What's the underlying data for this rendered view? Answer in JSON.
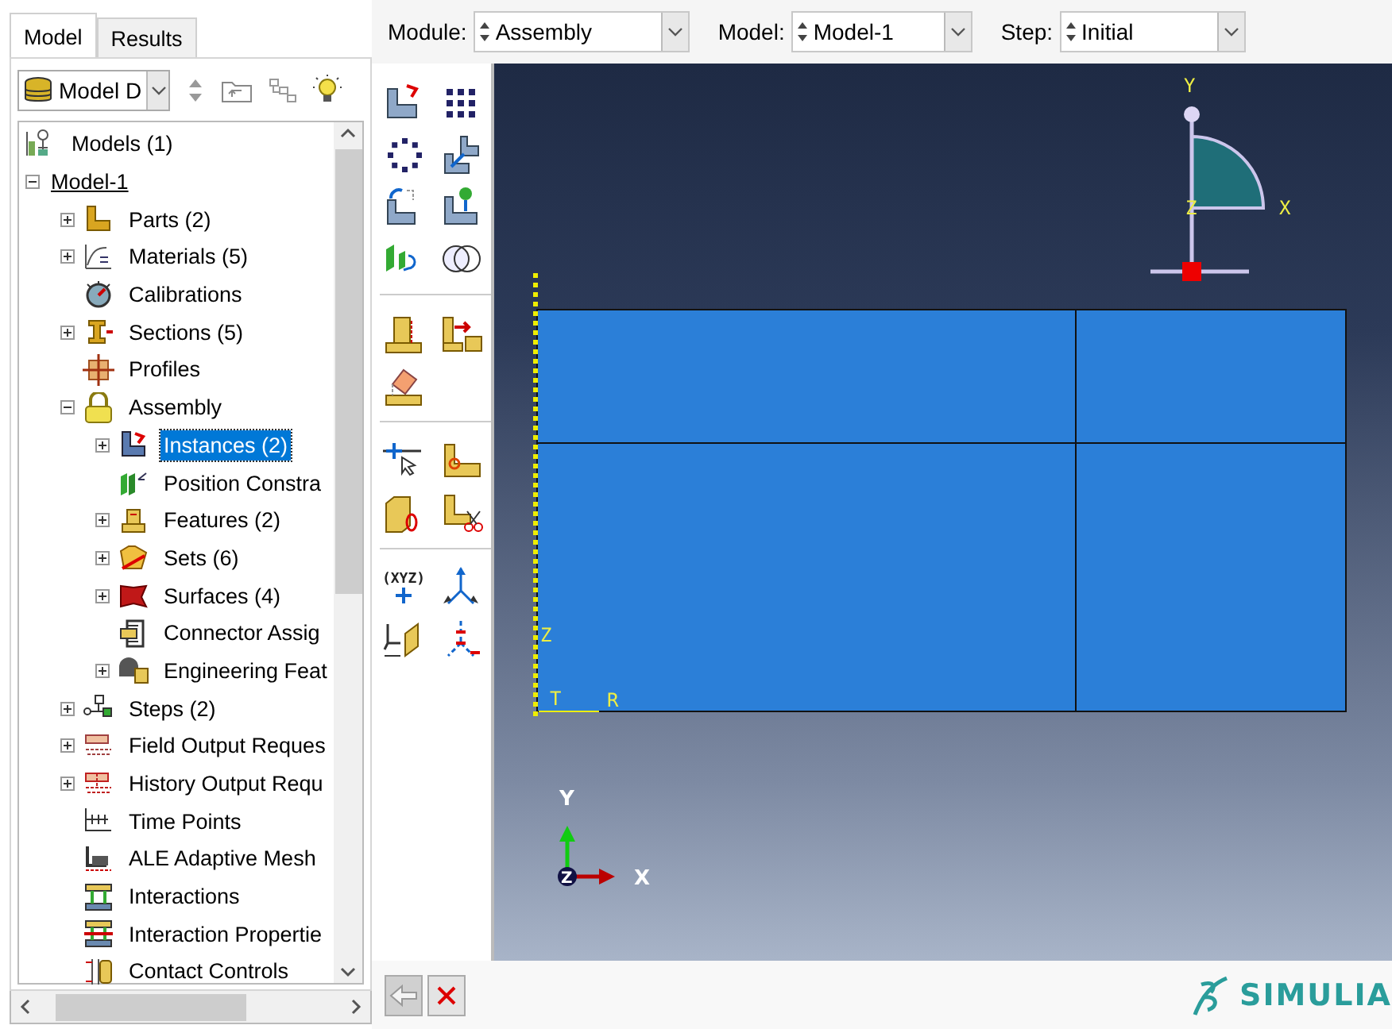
{
  "left_panel": {
    "tabs": [
      {
        "label": "Model",
        "selected": true
      },
      {
        "label": "Results",
        "selected": false
      }
    ],
    "tree_selector": {
      "value": "Model D"
    },
    "tree": [
      {
        "label": "Models (1)",
        "selected": false,
        "current": false,
        "children": [
          {
            "label": "Model-1",
            "expanded": true,
            "selected": false,
            "current": true,
            "children": [
              {
                "label": "Parts (2)",
                "expanded": false,
                "selected": false,
                "current": false
              },
              {
                "label": "Materials (5)",
                "expanded": false,
                "selected": false,
                "current": false
              },
              {
                "label": "Calibrations",
                "selected": false,
                "current": false
              },
              {
                "label": "Sections (5)",
                "expanded": false,
                "selected": false,
                "current": false
              },
              {
                "label": "Profiles",
                "selected": false,
                "current": false
              },
              {
                "label": "Assembly",
                "expanded": true,
                "selected": false,
                "current": false,
                "children": [
                  {
                    "label": "Instances (2)",
                    "expanded": false,
                    "selected": true,
                    "current": false
                  },
                  {
                    "label": "Position Constra",
                    "selected": false,
                    "current": false
                  },
                  {
                    "label": "Features (2)",
                    "expanded": false,
                    "selected": false,
                    "current": false
                  },
                  {
                    "label": "Sets (6)",
                    "expanded": false,
                    "selected": false,
                    "current": false
                  },
                  {
                    "label": "Surfaces (4)",
                    "expanded": false,
                    "selected": false,
                    "current": false
                  },
                  {
                    "label": "Connector Assig",
                    "selected": false,
                    "current": false
                  },
                  {
                    "label": "Engineering Feat",
                    "expanded": false,
                    "selected": false,
                    "current": false
                  }
                ]
              },
              {
                "label": "Steps (2)",
                "expanded": false,
                "selected": false,
                "current": false
              },
              {
                "label": "Field Output Reques",
                "expanded": false,
                "selected": false,
                "current": false
              },
              {
                "label": "History Output Requ",
                "expanded": false,
                "selected": false,
                "current": false
              },
              {
                "label": "Time Points",
                "selected": false,
                "current": false
              },
              {
                "label": "ALE Adaptive Mesh",
                "selected": false,
                "current": false
              },
              {
                "label": "Interactions",
                "selected": false,
                "current": false
              },
              {
                "label": "Interaction Propertie",
                "selected": false,
                "current": false
              },
              {
                "label": "Contact Controls",
                "selected": false,
                "current": false
              }
            ]
          }
        ]
      }
    ]
  },
  "context_bar": {
    "fields": [
      {
        "label": "Module:",
        "value": "Assembly"
      },
      {
        "label": "Model:",
        "value": "Model-1"
      },
      {
        "label": "Step:",
        "value": "Initial"
      }
    ]
  },
  "tool_palette": {
    "datum_point_label": "(XYZ)"
  },
  "viewport": {
    "view_triad": {
      "y": "Y",
      "x": "X",
      "z": "Z"
    },
    "axis_labels": [
      "Z",
      "T",
      "R"
    ],
    "global_triad": {
      "y": "Y",
      "x": "X",
      "z": "Z"
    }
  },
  "prompt_area": {
    "back_disabled": true
  },
  "brand": "SIMULIA"
}
